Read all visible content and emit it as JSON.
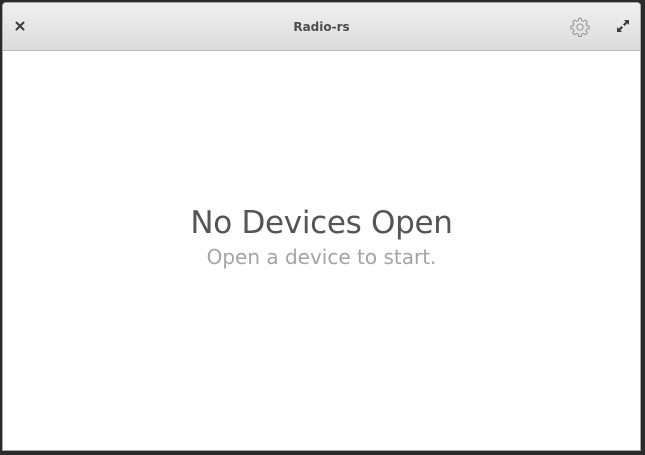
{
  "window": {
    "title": "Radio-rs"
  },
  "titlebar": {
    "close_icon": "close-icon",
    "settings_icon": "gear-icon",
    "maximize_icon": "maximize-icon"
  },
  "empty_state": {
    "title": "No Devices Open",
    "subtitle": "Open a device to start."
  },
  "colors": {
    "titlebar_top": "#f0f0f0",
    "titlebar_bottom": "#dcdcdc",
    "title_text": "#4d4d4d",
    "empty_title": "#555555",
    "empty_subtitle": "#a4a4a4",
    "background": "#ffffff"
  }
}
